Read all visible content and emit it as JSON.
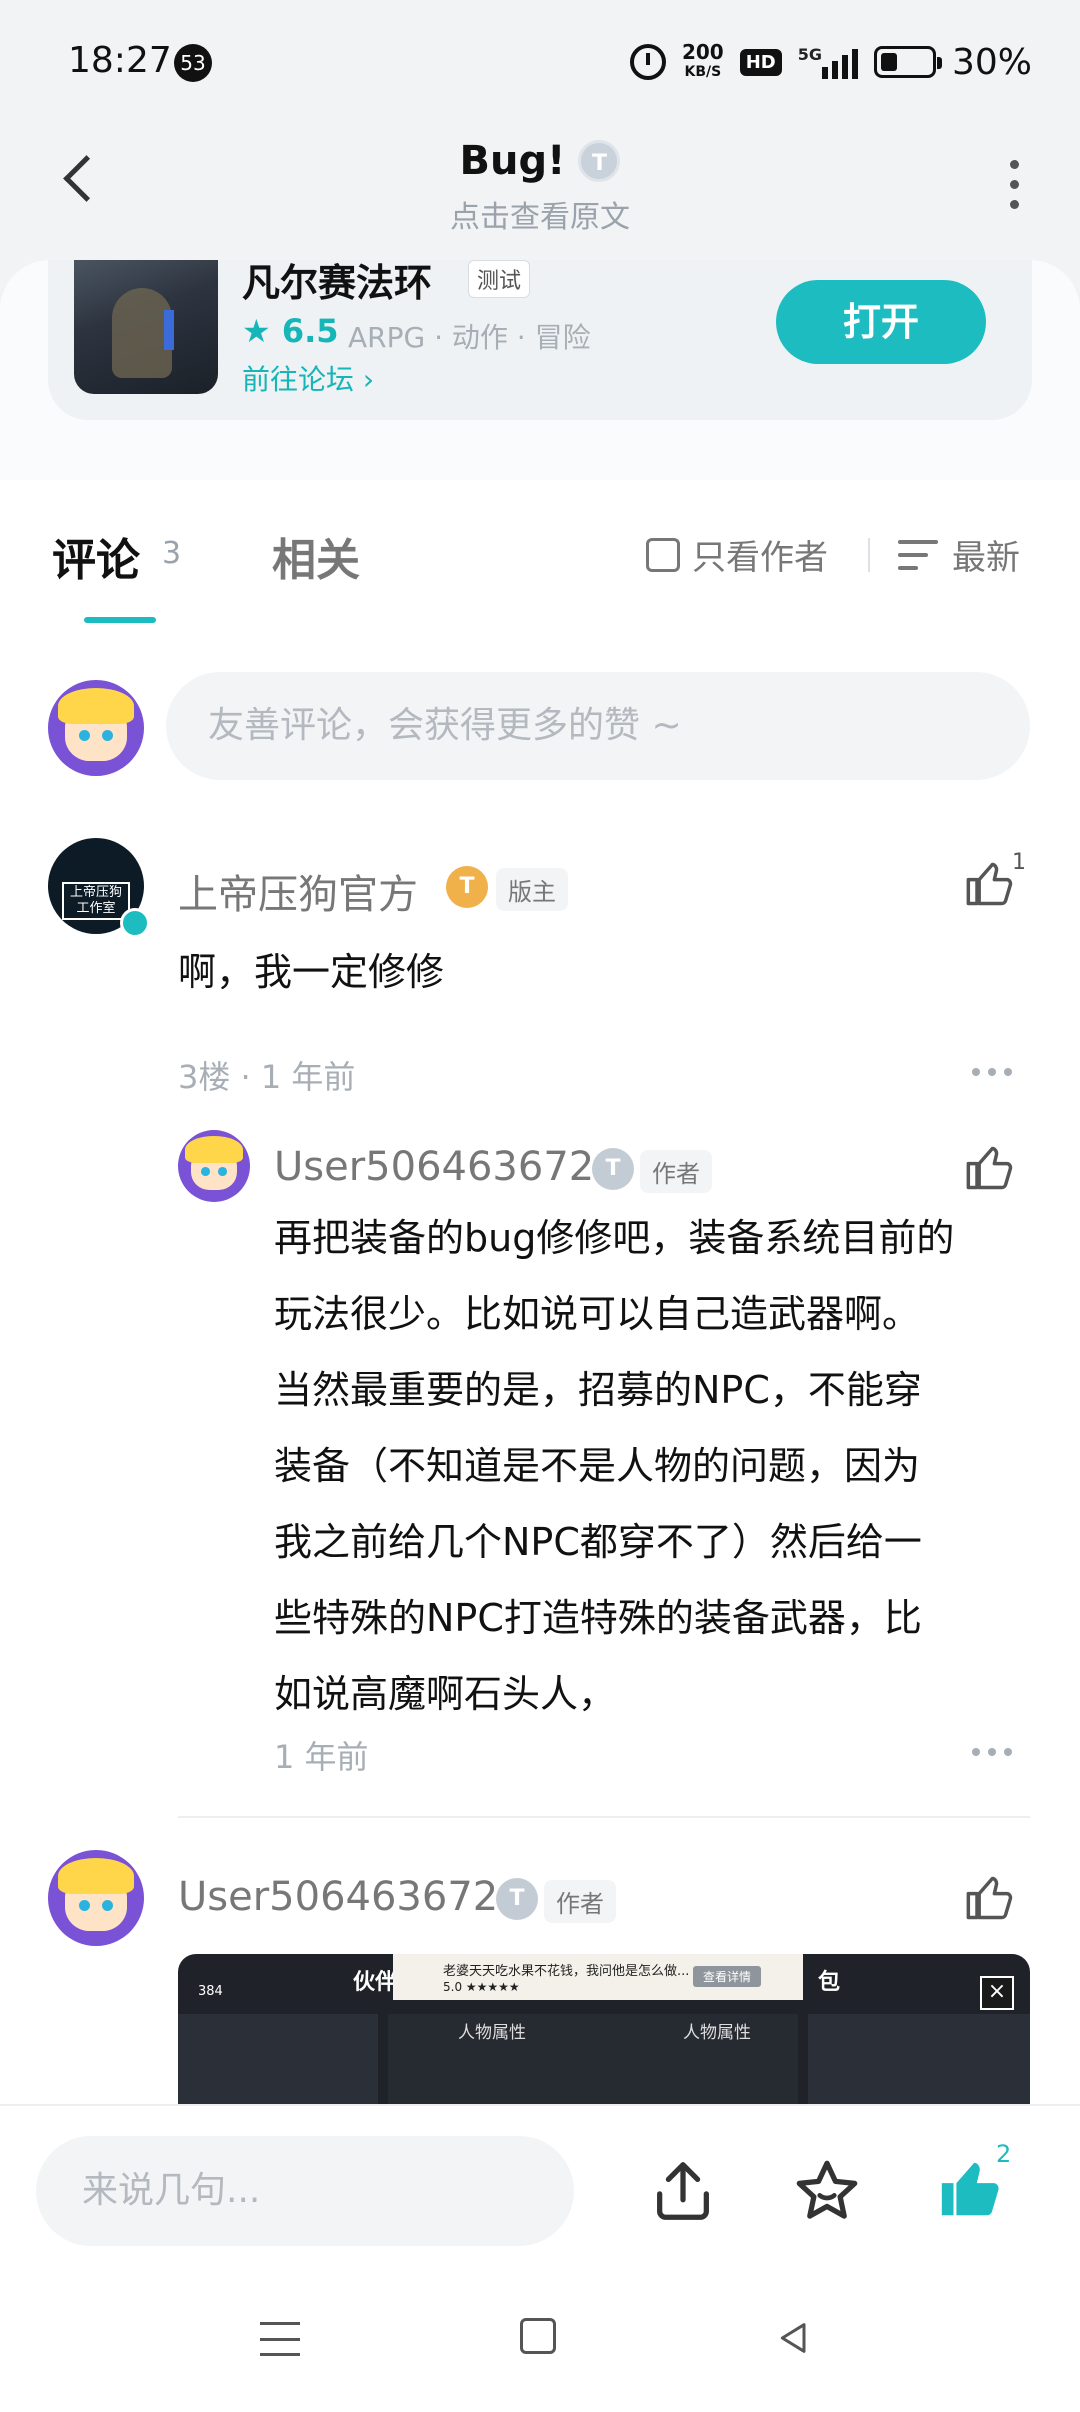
{
  "status_bar": {
    "time": "18:27",
    "notification_count": "53",
    "net_speed_value": "200",
    "net_speed_unit": "KB/S",
    "hd_label": "HD",
    "network_label": "5G",
    "battery": "30%"
  },
  "header": {
    "title": "Bug!",
    "title_badge": "T",
    "subtitle": "点击查看原文"
  },
  "game": {
    "name": "凡尔赛法环",
    "tag": "测试",
    "rating": "6.5",
    "genre": "ARPG · 动作 · 冒险",
    "forum_link": "前往论坛",
    "open_label": "打开",
    "accent_color": "#1cbcc0"
  },
  "tabs": {
    "comments_label": "评论",
    "comments_count": "3",
    "related_label": "相关",
    "author_only_label": "只看作者",
    "sort_label": "最新"
  },
  "comment_input": {
    "placeholder": "友善评论，会获得更多的赞 ~"
  },
  "comments": [
    {
      "user": "上帝压狗官方",
      "level_badge": "T",
      "role": "版主",
      "avatar_text": "上帝压狗工作室",
      "text": "啊，我一定修修",
      "meta": "3楼 · 1 年前",
      "likes": "1"
    }
  ],
  "reply": {
    "user": "User506463672",
    "level_badge": "T",
    "role": "作者",
    "text_lines": [
      "再把装备的bug修修吧，装备系统目前的",
      "玩法很少。比如说可以自己造武器啊。",
      "当然最重要的是，招募的NPC，不能穿",
      "装备（不知道是不是人物的问题，因为",
      "我之前给几个NPC都穿不了）然后给一",
      "些特殊的NPC打造特殊的装备武器，比",
      "如说高魔啊石头人，"
    ],
    "meta": "1 年前"
  },
  "comment2": {
    "user": "User506463672",
    "level_badge": "T",
    "role": "作者",
    "screenshot": {
      "coins": "384",
      "label_left": "伙伴",
      "label_right": "包",
      "banner_title": "老婆天天吃水果不花钱，我问他是怎么做...",
      "banner_score": "5.0 ★★★★★",
      "banner_button": "查看详情",
      "attr_left": "人物属性",
      "attr_right": "人物属性",
      "close": "×"
    }
  },
  "bottom_bar": {
    "placeholder": "来说几句...",
    "like_count": "2"
  }
}
